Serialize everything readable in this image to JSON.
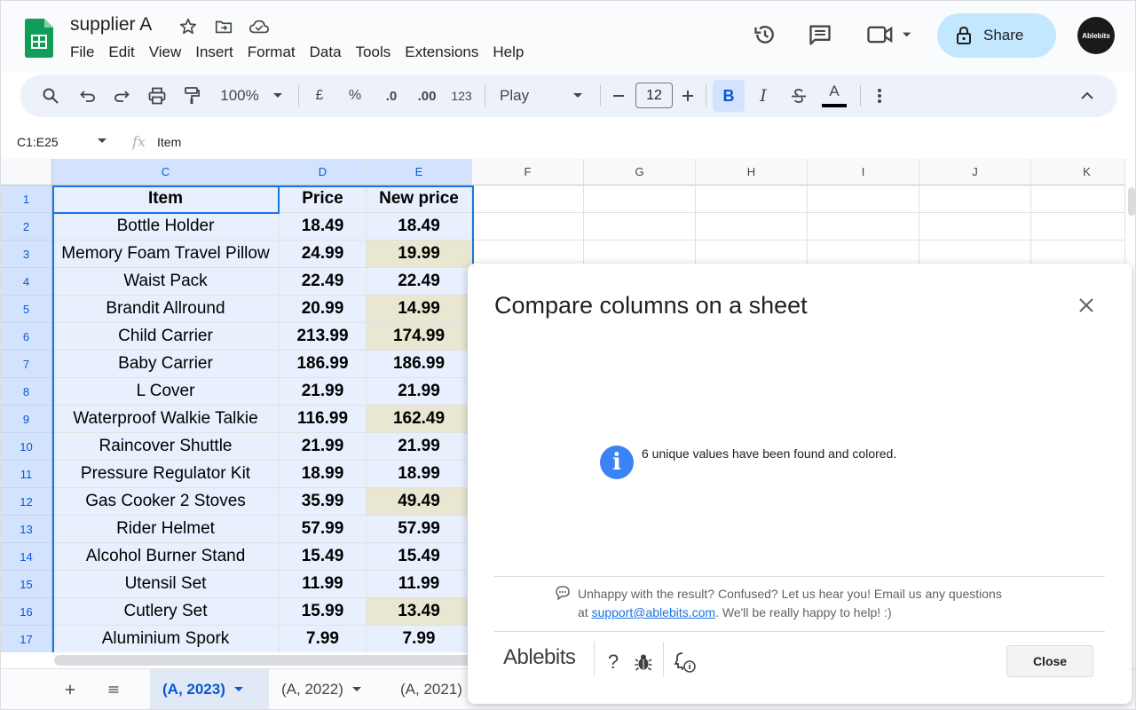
{
  "doc": {
    "title": "supplier A"
  },
  "menu": [
    "File",
    "Edit",
    "View",
    "Insert",
    "Format",
    "Data",
    "Tools",
    "Extensions",
    "Help"
  ],
  "header": {
    "share_label": "Share",
    "avatar_text": "Ablebits"
  },
  "toolbar": {
    "zoom": "100%",
    "currency": "£",
    "percent": "%",
    "dec_decrease": ".0",
    "dec_increase": ".00",
    "number_format": "123",
    "font": "Play",
    "font_size": "12",
    "bold": "B",
    "italic": "I",
    "text_color": "A"
  },
  "formula_bar": {
    "name_box": "C1:E25",
    "fx": "fx",
    "content": "Item"
  },
  "columns": [
    "C",
    "D",
    "E",
    "F",
    "G",
    "H",
    "I",
    "J",
    "K"
  ],
  "rows": [
    {
      "num": "1",
      "item": "Item",
      "price": "Price",
      "new_price": "New price",
      "changed": false
    },
    {
      "num": "2",
      "item": "Bottle Holder",
      "price": "18.49",
      "new_price": "18.49",
      "changed": false
    },
    {
      "num": "3",
      "item": "Memory Foam Travel Pillow",
      "price": "24.99",
      "new_price": "19.99",
      "changed": true
    },
    {
      "num": "4",
      "item": "Waist Pack",
      "price": "22.49",
      "new_price": "22.49",
      "changed": false
    },
    {
      "num": "5",
      "item": "Brandit Allround",
      "price": "20.99",
      "new_price": "14.99",
      "changed": true
    },
    {
      "num": "6",
      "item": "Child Carrier",
      "price": "213.99",
      "new_price": "174.99",
      "changed": true
    },
    {
      "num": "7",
      "item": "Baby Carrier",
      "price": "186.99",
      "new_price": "186.99",
      "changed": false
    },
    {
      "num": "8",
      "item": "L Cover",
      "price": "21.99",
      "new_price": "21.99",
      "changed": false
    },
    {
      "num": "9",
      "item": "Waterproof Walkie Talkie",
      "price": "116.99",
      "new_price": "162.49",
      "changed": true
    },
    {
      "num": "10",
      "item": "Raincover Shuttle",
      "price": "21.99",
      "new_price": "21.99",
      "changed": false
    },
    {
      "num": "11",
      "item": "Pressure Regulator Kit",
      "price": "18.99",
      "new_price": "18.99",
      "changed": false
    },
    {
      "num": "12",
      "item": "Gas Cooker 2 Stoves",
      "price": "35.99",
      "new_price": "49.49",
      "changed": true
    },
    {
      "num": "13",
      "item": "Rider Helmet",
      "price": "57.99",
      "new_price": "57.99",
      "changed": false
    },
    {
      "num": "14",
      "item": "Alcohol Burner Stand",
      "price": "15.49",
      "new_price": "15.49",
      "changed": false
    },
    {
      "num": "15",
      "item": "Utensil Set",
      "price": "11.99",
      "new_price": "11.99",
      "changed": false
    },
    {
      "num": "16",
      "item": "Cutlery Set",
      "price": "15.99",
      "new_price": "13.49",
      "changed": true
    },
    {
      "num": "17",
      "item": "Aluminium Spork",
      "price": "7.99",
      "new_price": "7.99",
      "changed": false
    }
  ],
  "tabs": [
    {
      "label": "(A, 2023)",
      "active": true
    },
    {
      "label": "(A, 2022)",
      "active": false
    },
    {
      "label": "(A, 2021)",
      "active": false
    }
  ],
  "dialog": {
    "title": "Compare columns on a sheet",
    "message": "6 unique values have been found and colored.",
    "feedback_line1": "Unhappy with the result? Confused? Let us hear you! Email us any questions",
    "feedback_at": "at ",
    "feedback_email": "support@ablebits.com",
    "feedback_line2_rest": ". We'll be really happy to help! :)",
    "brand": "Ablebits",
    "help_icon": "?",
    "close_label": "Close"
  },
  "colors": {
    "highlight": "#e9e6d1",
    "selection": "#e8f0fe",
    "accent": "#0b57d0",
    "share_bg": "#c2e7ff",
    "info_blue": "#3b82f6"
  }
}
